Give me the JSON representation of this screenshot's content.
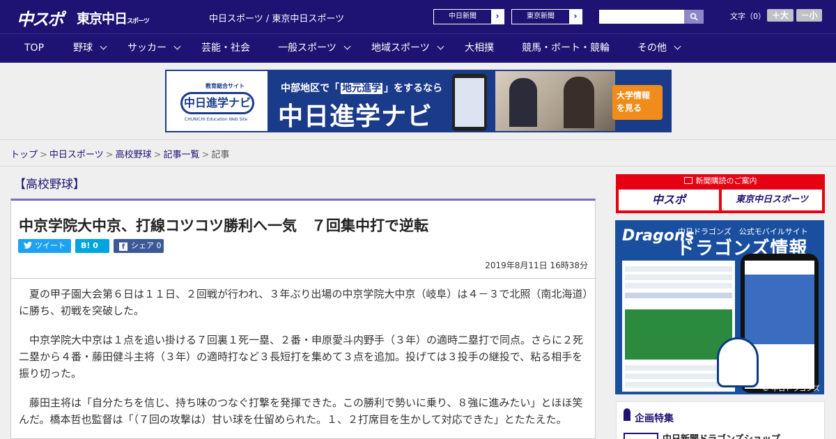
{
  "header": {
    "logo_chunichi_sports": "中スポ",
    "logo_tokyo": "東京中日",
    "logo_tokyo_small": "スポーツ",
    "site_title": "中日スポーツ / 東京中日スポーツ",
    "paper_links": [
      {
        "label": "中日新聞",
        "arrow": "›"
      },
      {
        "label": "東京新聞",
        "arrow": "›"
      }
    ],
    "search_placeholder": "",
    "font_size_label": "文字（0）",
    "font_bigger": "＋大",
    "font_smaller": "－小"
  },
  "nav": {
    "items": [
      {
        "label": "TOP",
        "dropdown": false
      },
      {
        "label": "野球",
        "dropdown": true
      },
      {
        "label": "サッカー",
        "dropdown": true
      },
      {
        "label": "芸能・社会",
        "dropdown": false
      },
      {
        "label": "一般スポーツ",
        "dropdown": true
      },
      {
        "label": "地域スポーツ",
        "dropdown": true
      },
      {
        "label": "大相撲",
        "dropdown": false
      },
      {
        "label": "競馬・ボート・競輪",
        "dropdown": false
      },
      {
        "label": "その他",
        "dropdown": true
      }
    ]
  },
  "banner": {
    "small": "教育総合サイト",
    "logo": "中日進学ナビ",
    "eng": "CHUNICHI Education Web Site",
    "tag_pre": "中部地区で「",
    "tag_hl": "地元進学",
    "tag_post": "」をするなら",
    "main": "中日進学ナビ",
    "cta_line1": "大学情報",
    "cta_line2": "を見る"
  },
  "breadcrumb": {
    "items": [
      "トップ",
      "中日スポーツ",
      "高校野球",
      "記事一覧"
    ],
    "current": "記事",
    "sep": ">"
  },
  "article": {
    "category": "【高校野球】",
    "headline": "中京学院大中京、打線コツコツ勝利へ一気　７回集中打で逆転",
    "share_twitter": "ツイート",
    "share_hatena": "B! 0",
    "share_facebook": "シェア 0",
    "date": "2019年8月11日 16時38分",
    "paragraphs": [
      "夏の甲子園大会第６日は１１日、２回戦が行われ、３年ぶり出場の中京学院大中京（岐阜）は４－３で北照（南北海道）に勝ち、初戦を突破した。",
      "中京学院大中京は１点を追い掛ける７回裏１死一塁、２番・申原愛斗内野手（３年）の適時二塁打で同点。さらに２死二塁から４番・藤田健斗主将（３年）の適時打など３長短打を集めて３点を追加。投げては３投手の継投で、粘る相手を振り切った。",
      "藤田主将は「自分たちを信じ、持ち味のつなぐ打撃を発揮できた。この勝利で勢いに乗り、８強に進みたい」とほほ笑んだ。橋本哲也監督は「（７回の攻撃は）甘い球を仕留められた。１、２打席目を生かして対応できた」とたたえた。"
    ]
  },
  "sidebar": {
    "subscribe_header": "新聞購読のご案内",
    "subscribe_logo1": "中スポ",
    "subscribe_logo2": "東京中日スポーツ",
    "dragons_logo": "Dragons",
    "dragons_sub": "中日ドラゴンズ　公式モバイルサイト",
    "dragons_title": "ドラゴンズ情報",
    "dragons_copy": "© 中日ドラゴンズ",
    "special_title": "企画特集",
    "special_item": "中日新聞ドラゴンズショップ"
  },
  "colors": {
    "header_bg": "#1e1273",
    "twitter": "#1da1f2",
    "hatena": "#00a4de",
    "facebook": "#3b5998",
    "subscribe_red": "#e50012"
  }
}
